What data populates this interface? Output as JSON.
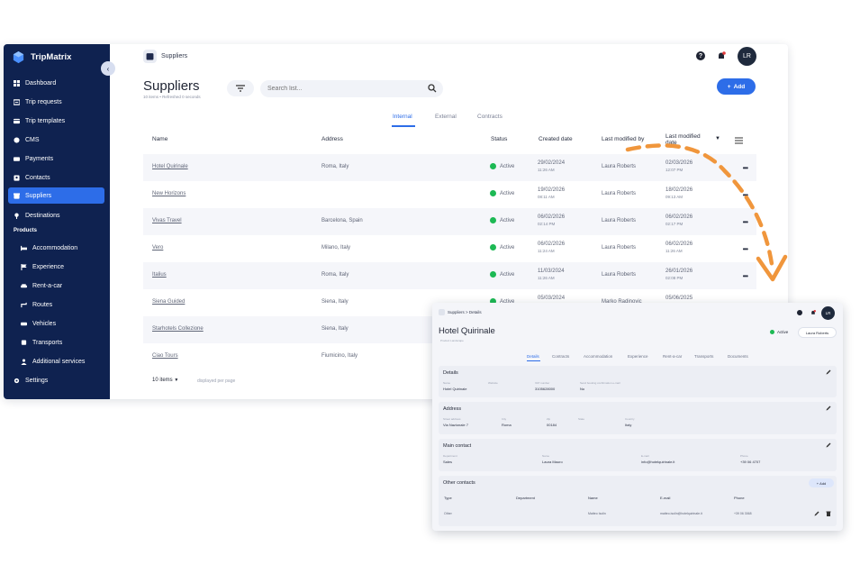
{
  "app": {
    "brand": "TripMatrix"
  },
  "colors": {
    "sidebar": "#0f2250",
    "accent": "#2d6de8",
    "status_active": "#1db954",
    "arrow": "#f0963c"
  },
  "sidebar": {
    "items": [
      {
        "label": "Dashboard",
        "icon": "dashboard-icon"
      },
      {
        "label": "Trip requests",
        "icon": "requests-icon"
      },
      {
        "label": "Trip templates",
        "icon": "templates-icon"
      },
      {
        "label": "CMS",
        "icon": "cms-icon"
      },
      {
        "label": "Payments",
        "icon": "payments-icon"
      },
      {
        "label": "Contacts",
        "icon": "contacts-icon"
      },
      {
        "label": "Suppliers",
        "icon": "suppliers-icon"
      },
      {
        "label": "Destinations",
        "icon": "destinations-icon"
      }
    ],
    "products_heading": "Products",
    "products": [
      {
        "label": "Accommodation",
        "icon": "bed-icon"
      },
      {
        "label": "Experience",
        "icon": "flag-icon"
      },
      {
        "label": "Rent-a-car",
        "icon": "car-icon"
      },
      {
        "label": "Routes",
        "icon": "route-icon"
      },
      {
        "label": "Vehicles",
        "icon": "vehicle-icon"
      },
      {
        "label": "Transports",
        "icon": "transport-icon"
      },
      {
        "label": "Additional services",
        "icon": "services-icon"
      }
    ],
    "settings": "Settings"
  },
  "header": {
    "breadcrumb": "Suppliers",
    "avatar": "LR"
  },
  "page": {
    "title": "Suppliers",
    "subtitle": "10 items • Refreshed 0 seconds",
    "search_placeholder": "Search list...",
    "add_label": "Add",
    "tabs": [
      "Internal",
      "External",
      "Contracts"
    ]
  },
  "table": {
    "columns": [
      "Name",
      "Address",
      "Status",
      "Created date",
      "Last modified by",
      "Last modified date"
    ],
    "rows": [
      {
        "name": "Hotel Quirinale",
        "address": "Roma, Italy",
        "status": "Active",
        "created_date": "29/02/2024",
        "created_time": "11:26 AM",
        "modified_by": "Laura Roberts",
        "modified_date": "02/03/2026",
        "modified_time": "12:07 PM"
      },
      {
        "name": "New Horizons",
        "address": "",
        "status": "Active",
        "created_date": "19/02/2026",
        "created_time": "08:11 AM",
        "modified_by": "Laura Roberts",
        "modified_date": "18/02/2026",
        "modified_time": "09:13 AM"
      },
      {
        "name": "Vivas Travel",
        "address": "Barcelona, Spain",
        "status": "Active",
        "created_date": "06/02/2026",
        "created_time": "02:14 PM",
        "modified_by": "Laura Roberts",
        "modified_date": "06/02/2026",
        "modified_time": "02:17 PM"
      },
      {
        "name": "Vero",
        "address": "Milano, Italy",
        "status": "Active",
        "created_date": "06/02/2026",
        "created_time": "11:24 AM",
        "modified_by": "Laura Roberts",
        "modified_date": "06/02/2026",
        "modified_time": "11:26 AM"
      },
      {
        "name": "Italius",
        "address": "Roma, Italy",
        "status": "Active",
        "created_date": "11/03/2024",
        "created_time": "11:26 AM",
        "modified_by": "Laura Roberts",
        "modified_date": "26/01/2026",
        "modified_time": "02:08 PM"
      },
      {
        "name": "Siena Guided",
        "address": "Siena, Italy",
        "status": "Active",
        "created_date": "05/03/2024",
        "created_time": "",
        "modified_by": "Marko Radinovic",
        "modified_date": "05/06/2025",
        "modified_time": ""
      },
      {
        "name": "Starhotels Collezione",
        "address": "Siena, Italy",
        "status": "",
        "created_date": "",
        "created_time": "",
        "modified_by": "",
        "modified_date": "",
        "modified_time": ""
      },
      {
        "name": "Ciao Tours",
        "address": "Fiumicino, Italy",
        "status": "",
        "created_date": "",
        "created_time": "",
        "modified_by": "",
        "modified_date": "",
        "modified_time": ""
      }
    ],
    "items_per_page": "10 items",
    "per_page_label": "displayed per page"
  },
  "detail": {
    "breadcrumb": "Suppliers  >  Details",
    "title": "Hotel Quirinale",
    "subtitle": "Product Landscape",
    "status": "Active",
    "owner": "Laura Roberts",
    "avatar": "LR",
    "tabs": [
      "Details",
      "Contracts",
      "Accommodation",
      "Experience",
      "Rent-a-car",
      "Transports",
      "Documents"
    ],
    "details_card": {
      "title": "Details",
      "fields": [
        {
          "label": "Name",
          "value": "Hotel Quirinale"
        },
        {
          "label": "Website",
          "value": ""
        },
        {
          "label": "VAT number",
          "value": "3105628000"
        },
        {
          "label": "Send booking confirmation e-mail",
          "value": "No"
        }
      ]
    },
    "address_card": {
      "title": "Address",
      "fields": [
        {
          "label": "Street address",
          "value": "Via Nazionale 7"
        },
        {
          "label": "City",
          "value": "Roma"
        },
        {
          "label": "Zip",
          "value": "00184"
        },
        {
          "label": "State",
          "value": ""
        },
        {
          "label": "Country",
          "value": "Italy"
        }
      ]
    },
    "main_contact_card": {
      "title": "Main contact",
      "fields": [
        {
          "label": "Department",
          "value": "Sales"
        },
        {
          "label": "Name",
          "value": "Laura Mauro"
        },
        {
          "label": "E-mail",
          "value": "info@hotelquirinale.it"
        },
        {
          "label": "Phone",
          "value": "+39 06 4707"
        }
      ]
    },
    "other_contacts": {
      "title": "Other contacts",
      "add_label": "Add",
      "columns": [
        "Type",
        "Department",
        "Name",
        "E-mail",
        "Phone"
      ],
      "row": {
        "type": "Other",
        "department": "",
        "name": "Matteo Isolin",
        "email": "matteo.isolin@hotelquirinale.it",
        "phone": "+39 06 3068"
      }
    }
  }
}
